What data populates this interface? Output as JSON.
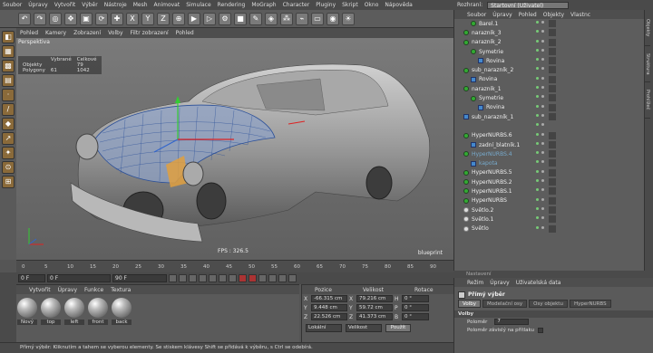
{
  "menu": [
    "Soubor",
    "Úpravy",
    "Vytvořit",
    "Výběr",
    "Nástroje",
    "Mesh",
    "Animovat",
    "Simulace",
    "Rendering",
    "MoGraph",
    "Character",
    "Pluginy",
    "Skript",
    "Okno",
    "Nápověda"
  ],
  "layout": {
    "label": "Rozhraní:",
    "value": "Startovní (Uživatel)"
  },
  "viewport": {
    "menu": [
      "Pohled",
      "Kamery",
      "Zobrazení",
      "Volby",
      "Filtr zobrazení",
      "Pohled"
    ],
    "label": "Perspektiva",
    "stats": {
      "header": [
        "Vybrané",
        "Celkové"
      ],
      "rows": [
        [
          "Objekty",
          "",
          "79"
        ],
        [
          "Polygony",
          "61",
          "1042"
        ]
      ]
    },
    "fps": "FPS : 326.5",
    "blueprint": "blueprint"
  },
  "timeline": {
    "ticks": [
      "0",
      "5",
      "10",
      "15",
      "20",
      "25",
      "30",
      "35",
      "40",
      "45",
      "50",
      "55",
      "60",
      "65",
      "70",
      "75",
      "80",
      "85",
      "90"
    ],
    "end": "0 F"
  },
  "transport": {
    "start": "0 F",
    "cur": "0 F",
    "end": "90 F"
  },
  "materials": {
    "menu": [
      "Vytvořit",
      "Úpravy",
      "Funkce",
      "Textura"
    ],
    "items": [
      "Nový",
      "top",
      "left",
      "front",
      "back"
    ]
  },
  "coords": {
    "headers": [
      "Pozice",
      "Velikost",
      "Rotace"
    ],
    "rows": [
      {
        "axis": "X",
        "pos": "-66.315 cm",
        "size": "79.216 cm",
        "rlbl": "H",
        "rot": "0 °"
      },
      {
        "axis": "Y",
        "pos": "9.448 cm",
        "size": "59.72 cm",
        "rlbl": "P",
        "rot": "0 °"
      },
      {
        "axis": "Z",
        "pos": "22.526 cm",
        "size": "41.373 cm",
        "rlbl": "B",
        "rot": "0 °"
      }
    ],
    "mode1": "Lokální",
    "mode2": "Velikost",
    "apply": "Použít"
  },
  "status": "Přímý výběr: Kliknutím a tahem se vyberou elementy. Se stiskem klávesy Shift se přidává k výběru, s Ctrl se odebírá.",
  "objects": {
    "menu": [
      "Soubor",
      "Úpravy",
      "Pohled",
      "Objekty",
      "Vlastnc"
    ],
    "items": [
      {
        "name": "Barel.1",
        "indent": 1,
        "icon": "nurbs",
        "hi": false
      },
      {
        "name": "narazník_3",
        "indent": 0,
        "icon": "nurbs",
        "hi": false
      },
      {
        "name": "narazník_2",
        "indent": 0,
        "icon": "nurbs",
        "hi": false
      },
      {
        "name": "Symetrie",
        "indent": 1,
        "icon": "nurbs",
        "hi": false
      },
      {
        "name": "Rovina",
        "indent": 2,
        "icon": "poly",
        "hi": false
      },
      {
        "name": "sub_narazník_2",
        "indent": 0,
        "icon": "nurbs",
        "hi": false
      },
      {
        "name": "Rovina",
        "indent": 1,
        "icon": "poly",
        "hi": false
      },
      {
        "name": "narazník_1",
        "indent": 0,
        "icon": "nurbs",
        "hi": false
      },
      {
        "name": "Symetrie",
        "indent": 1,
        "icon": "nurbs",
        "hi": false
      },
      {
        "name": "Rovina",
        "indent": 2,
        "icon": "poly",
        "hi": false
      },
      {
        "name": "sub_narazník_1",
        "indent": 0,
        "icon": "poly",
        "hi": false
      },
      {
        "name": "",
        "indent": 0,
        "icon": "none",
        "hi": false
      },
      {
        "name": "HyperNURBS.6",
        "indent": 0,
        "icon": "nurbs",
        "hi": false
      },
      {
        "name": "zadní_blatník.1",
        "indent": 1,
        "icon": "poly",
        "hi": false
      },
      {
        "name": "HyperNURBS.4",
        "indent": 0,
        "icon": "nurbs",
        "hi": true
      },
      {
        "name": "kapota",
        "indent": 1,
        "icon": "poly",
        "hi": true
      },
      {
        "name": "HyperNURBS.5",
        "indent": 0,
        "icon": "nurbs",
        "hi": false
      },
      {
        "name": "HyperNURBS.2",
        "indent": 0,
        "icon": "nurbs",
        "hi": false
      },
      {
        "name": "HyperNURBS.1",
        "indent": 0,
        "icon": "nurbs",
        "hi": false
      },
      {
        "name": "HyperNURBS",
        "indent": 0,
        "icon": "nurbs",
        "hi": false
      },
      {
        "name": "Světlo.2",
        "indent": 0,
        "icon": "lamp",
        "hi": false
      },
      {
        "name": "Světlo.1",
        "indent": 0,
        "icon": "lamp",
        "hi": false
      },
      {
        "name": "Světlo",
        "indent": 0,
        "icon": "lamp",
        "hi": false
      }
    ]
  },
  "nastaveni": "Nastavení",
  "attributes": {
    "menu": [
      "Režim",
      "Úpravy",
      "Uživatelská data"
    ],
    "title": "Přímý výběr",
    "tabs": [
      "Volby",
      "Modelační osy",
      "Osy objektu",
      "HyperNURBS"
    ],
    "section": "Volby",
    "radius_label": "Poloměr",
    "radius_value": "7",
    "sub_label": "Poloměr závislý na přítlaku"
  },
  "rtabs": [
    "Objekty",
    "Struktura",
    "Prohlížeč"
  ]
}
